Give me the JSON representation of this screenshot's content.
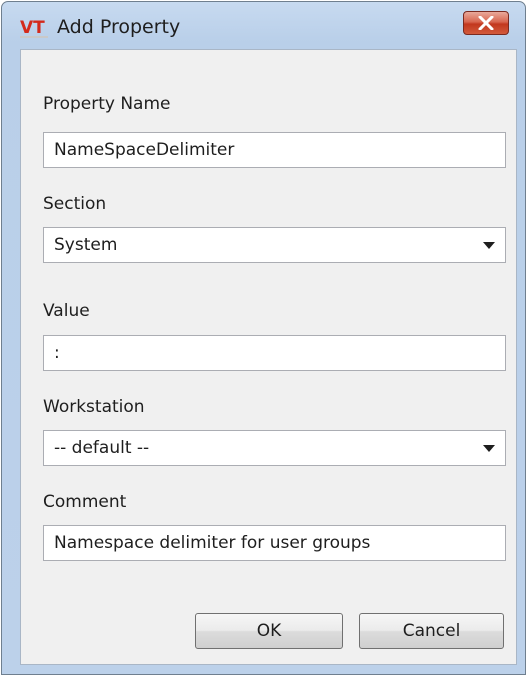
{
  "window": {
    "title": "Add Property",
    "logo_icon": "vt-logo-icon",
    "close_icon": "close-icon"
  },
  "form": {
    "property_name": {
      "label": "Property Name",
      "value": "NameSpaceDelimiter"
    },
    "section": {
      "label": "Section",
      "value": "System"
    },
    "value": {
      "label": "Value",
      "value": ":"
    },
    "workstation": {
      "label": "Workstation",
      "value": "-- default --"
    },
    "comment": {
      "label": "Comment",
      "value": "Namespace delimiter for user groups"
    }
  },
  "buttons": {
    "ok": "OK",
    "cancel": "Cancel"
  },
  "colors": {
    "logo_red": "#d42a1c",
    "close_red": "#c2381e"
  }
}
